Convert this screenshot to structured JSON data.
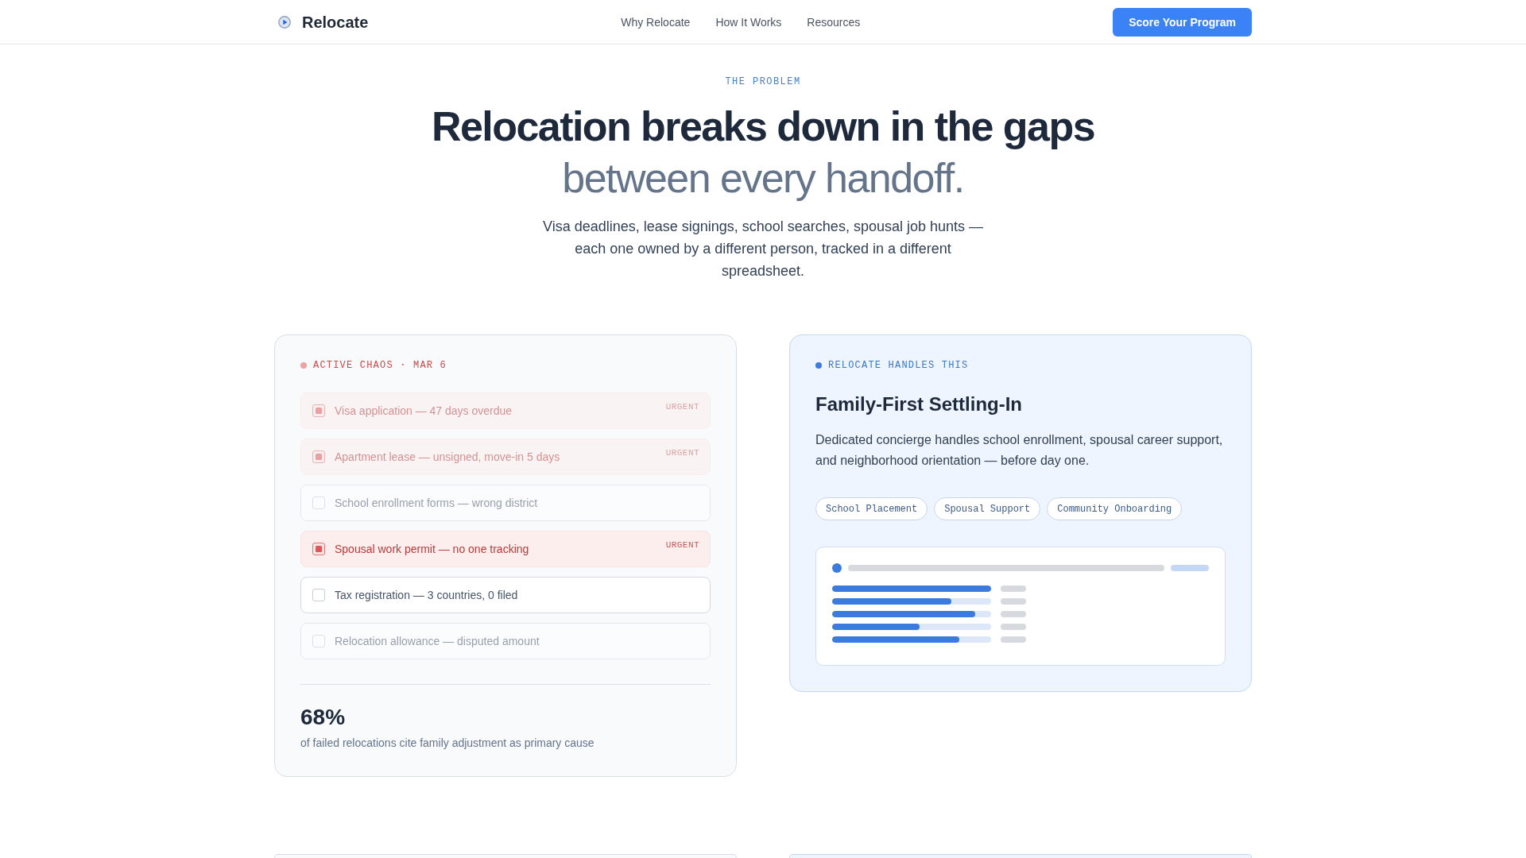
{
  "nav": {
    "brand": "Relocate",
    "links": [
      "Why Relocate",
      "How It Works",
      "Resources"
    ],
    "cta": "Score Your Program"
  },
  "hero": {
    "eyebrow": "THE PROBLEM",
    "title": "Relocation breaks down in the gaps",
    "title_muted": "between every handoff.",
    "body": "Visa deadlines, lease signings, school searches, spousal job hunts — each one owned by a different person, tracked in a different spreadsheet."
  },
  "chaos_card": {
    "label": "ACTIVE CHAOS · MAR 6",
    "items": [
      {
        "text": "Visa application — 47 days overdue",
        "urgent": true,
        "tag": "URGENT",
        "dimmed": true
      },
      {
        "text": "Apartment lease — unsigned, move-in 5 days",
        "urgent": true,
        "tag": "URGENT",
        "dimmed": true
      },
      {
        "text": "School enrollment forms — wrong district",
        "urgent": false,
        "dimmed": true
      },
      {
        "text": "Spousal work permit — no one tracking",
        "urgent": true,
        "tag": "URGENT",
        "dimmed": false
      },
      {
        "text": "Tax registration — 3 countries, 0 filed",
        "urgent": false,
        "dimmed": false
      },
      {
        "text": "Relocation allowance — disputed amount",
        "urgent": false,
        "dimmed": true
      }
    ],
    "stat": "68%",
    "stat_caption": "of failed relocations cite family adjustment as primary cause"
  },
  "solution_card": {
    "label": "RELOCATE HANDLES THIS",
    "title": "Family-First Settling-In",
    "body": "Dedicated concierge handles school enrollment, spousal career support, and neighborhood orientation — before day one.",
    "tags": [
      "School Placement",
      "Spousal Support",
      "Community Onboarding"
    ],
    "preview": {
      "bars": [
        {
          "level": 1
        },
        {
          "level": 0.75
        },
        {
          "level": 0.9
        },
        {
          "level": 0.55
        },
        {
          "level": 0.8
        }
      ]
    }
  }
}
